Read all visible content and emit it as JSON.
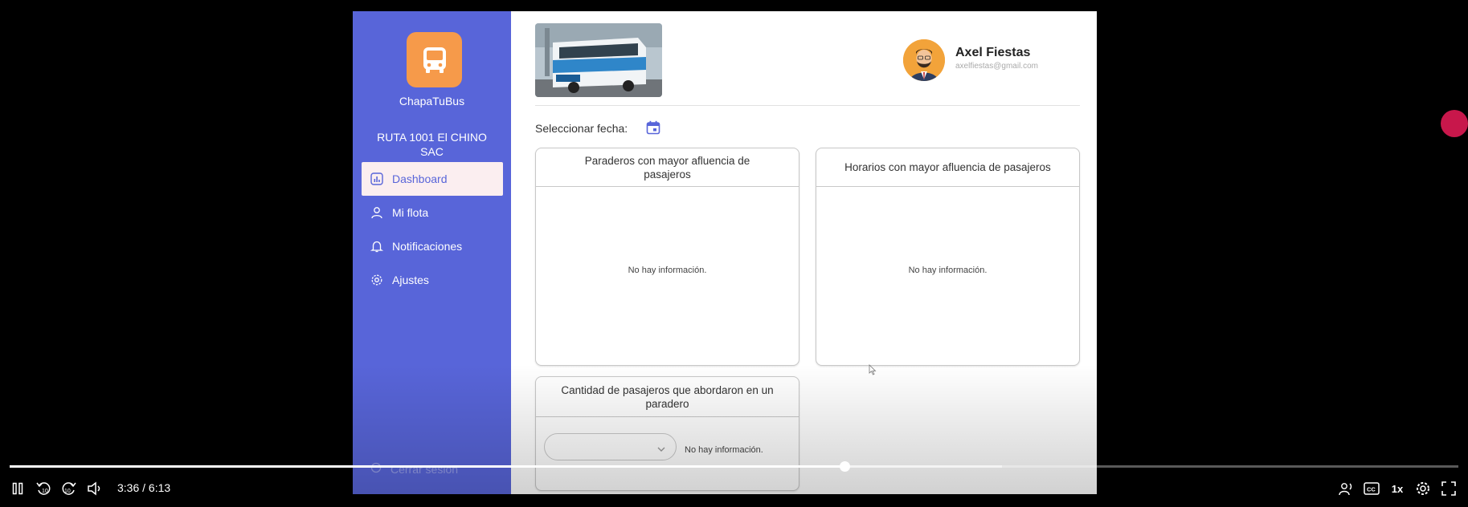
{
  "app": {
    "brand": "ChapaTuBus",
    "route": "RUTA 1001 El CHINO SAC"
  },
  "sidebar": {
    "items": [
      {
        "label": "Dashboard",
        "icon": "dashboard-icon",
        "active": true
      },
      {
        "label": "Mi flota",
        "icon": "user-icon",
        "active": false
      },
      {
        "label": "Notificaciones",
        "icon": "bell-icon",
        "active": false
      },
      {
        "label": "Ajustes",
        "icon": "gear-icon",
        "active": false
      }
    ],
    "logout": "Cerrar sesión"
  },
  "header": {
    "user_name": "Axel Fiestas",
    "user_email": "axelfiestas@gmail.com"
  },
  "filters": {
    "date_label": "Seleccionar fecha:"
  },
  "cards": {
    "stops": {
      "title": "Paraderos con mayor afluencia de pasajeros",
      "empty": "No hay información."
    },
    "schedules": {
      "title": "Horarios con mayor afluencia de pasajeros",
      "empty": "No hay información."
    },
    "boarded": {
      "title": "Cantidad de pasajeros que abordaron en un paradero",
      "empty": "No hay información.",
      "select_value": ""
    }
  },
  "player": {
    "time": "3:36 / 6:13",
    "progress": 0.576,
    "buffered": 0.685,
    "speed": "1x"
  },
  "colors": {
    "sidebar": "#5865d9",
    "logo": "#f69a4a",
    "active_nav_bg": "#fbeef0",
    "record_dot": "#c8174b"
  }
}
